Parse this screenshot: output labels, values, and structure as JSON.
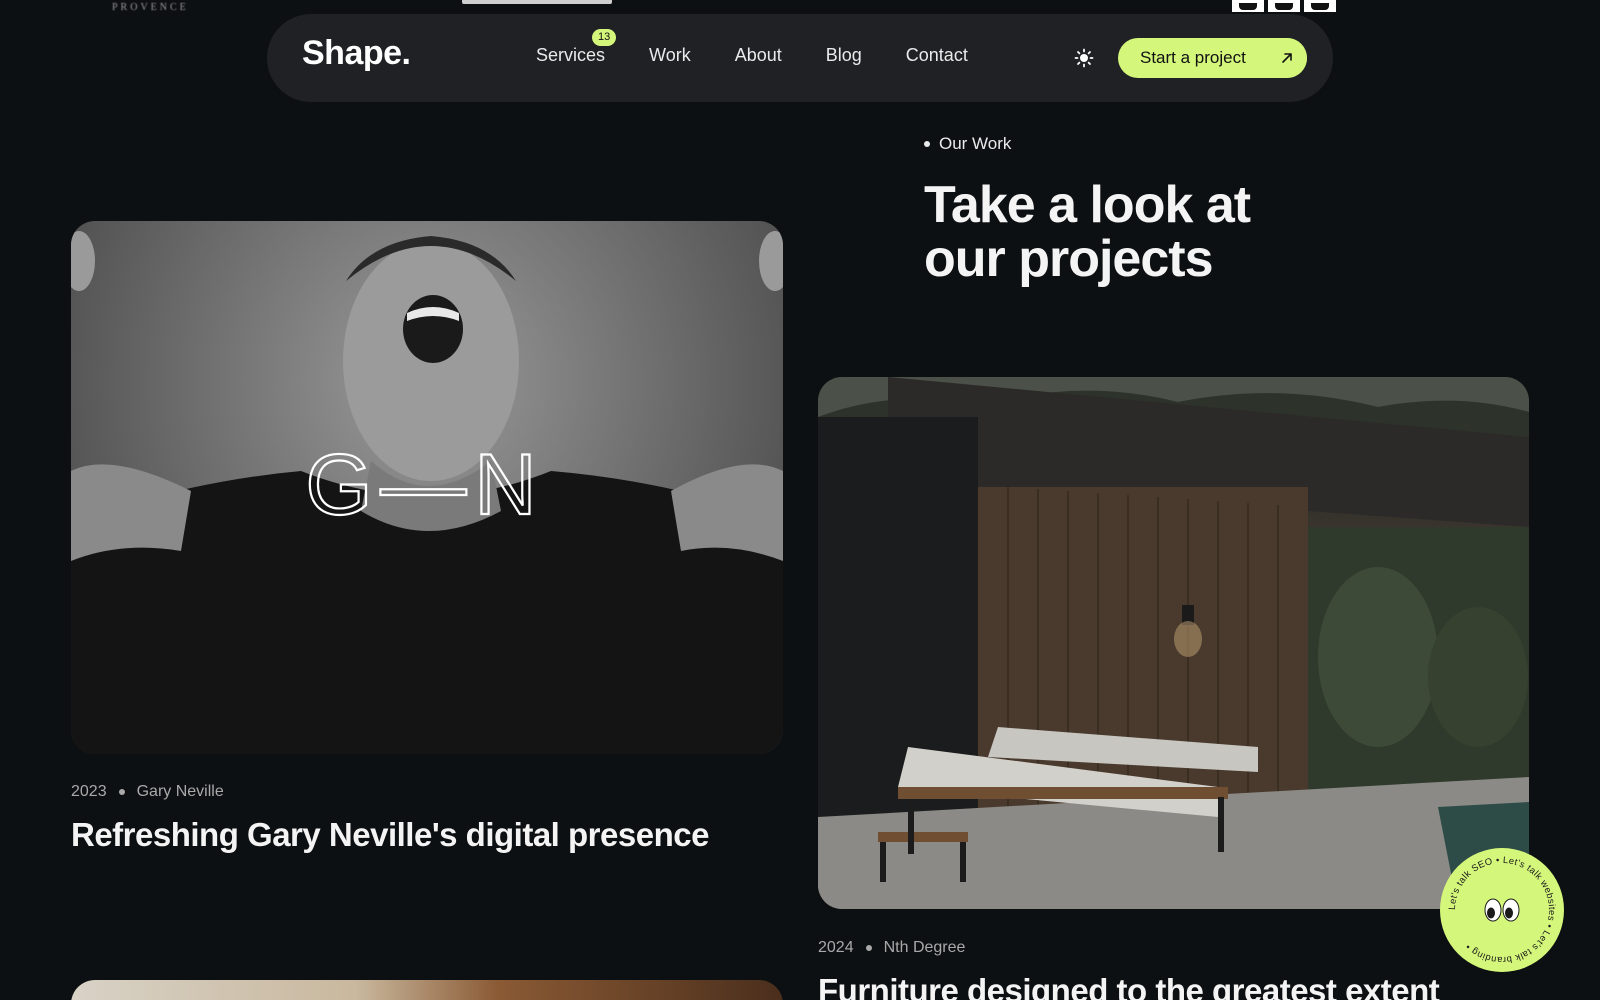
{
  "logo_strip": {
    "provence": "PROVENCE"
  },
  "nav": {
    "brand": "Shape.",
    "items": [
      {
        "label": "Services",
        "badge": "13"
      },
      {
        "label": "Work"
      },
      {
        "label": "About"
      },
      {
        "label": "Blog"
      },
      {
        "label": "Contact"
      }
    ],
    "theme_icon": "sun-icon",
    "cta_label": "Start a project",
    "cta_icon": "arrow-up-right-icon"
  },
  "section": {
    "eyebrow": "Our Work",
    "heading_line1": "Take a look at",
    "heading_line2": "our projects"
  },
  "projects": [
    {
      "year": "2023",
      "client": "Gary Neville",
      "title": "Refreshing Gary Neville's digital presence",
      "image_overlay": "G—N"
    },
    {
      "year": "2024",
      "client": "Nth Degree",
      "title": "Furniture designed to the greatest extent"
    }
  ],
  "talk_badge": {
    "ring_text": "Let's talk SEO • Let's talk websites • Let's talk branding •"
  },
  "colors": {
    "background": "#0d1012",
    "nav_bg": "#1f2124",
    "accent": "#d4f77b"
  }
}
